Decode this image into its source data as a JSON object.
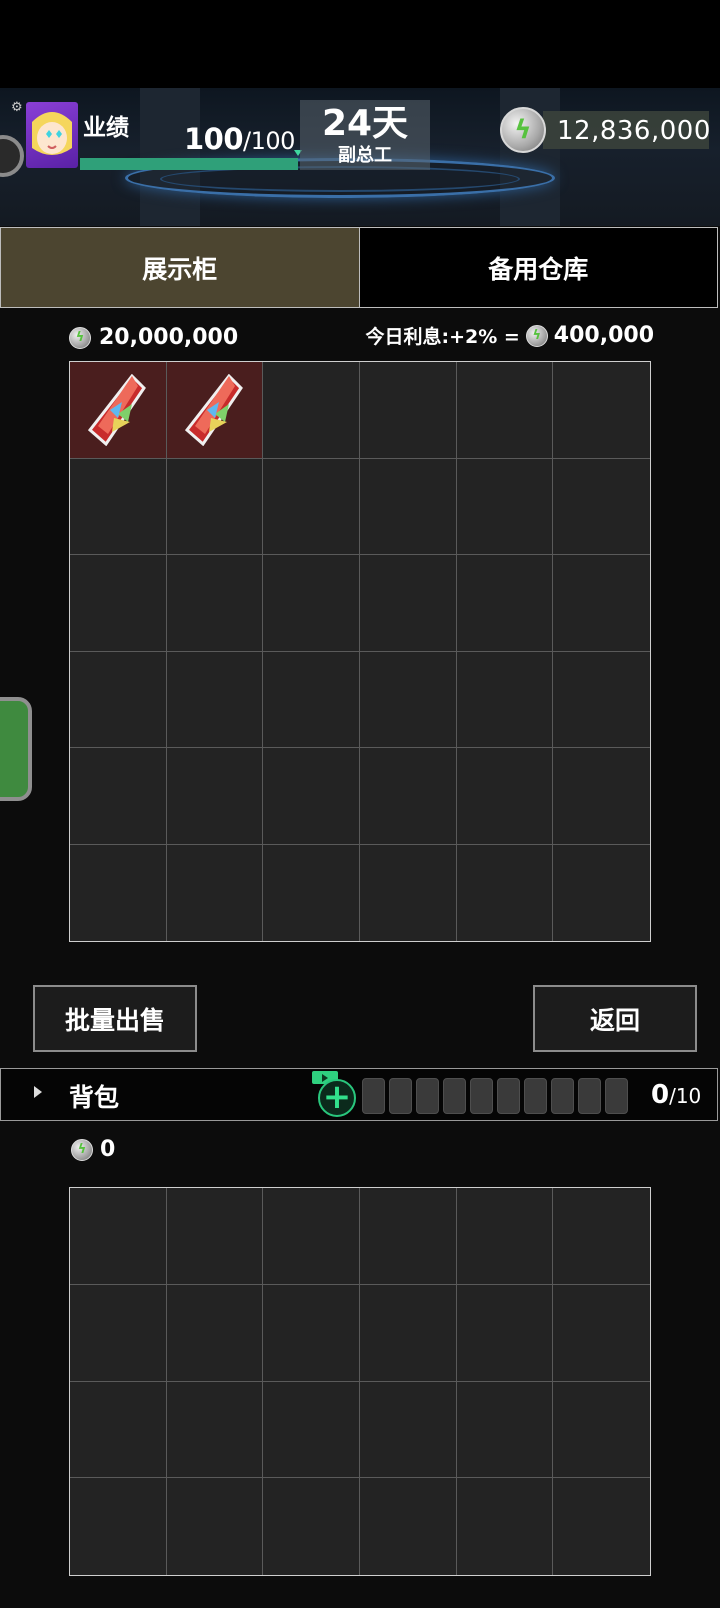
{
  "header": {
    "performance_label": "业绩",
    "performance_current": "100",
    "performance_max": "/100",
    "performance_fraction": 1.0,
    "day_value": "24天",
    "rank_title": "副总工",
    "money": "12,836,000",
    "coin_icon": "lightning-coin-icon"
  },
  "tabs": [
    {
      "label": "展示柜",
      "active": true
    },
    {
      "label": "备用仓库",
      "active": false
    }
  ],
  "cabinet": {
    "balance": "20,000,000",
    "interest_label": "今日利息:+2% =",
    "interest_value": "400,000",
    "rows": 6,
    "cols": 6,
    "items": [
      {
        "slot": 0,
        "icon": "red-crystal-icon"
      },
      {
        "slot": 1,
        "icon": "red-crystal-icon"
      }
    ]
  },
  "actions": {
    "bulk_sell": "批量出售",
    "back": "返回"
  },
  "backpack": {
    "title": "背包",
    "count": "0",
    "capacity": "/10",
    "locked_slots": 10,
    "balance": "0",
    "rows": 4,
    "cols": 6
  },
  "colors": {
    "accent_green": "#2fa079",
    "active_tab": "#4c4530",
    "filled_cell": "#4a1e1e"
  }
}
